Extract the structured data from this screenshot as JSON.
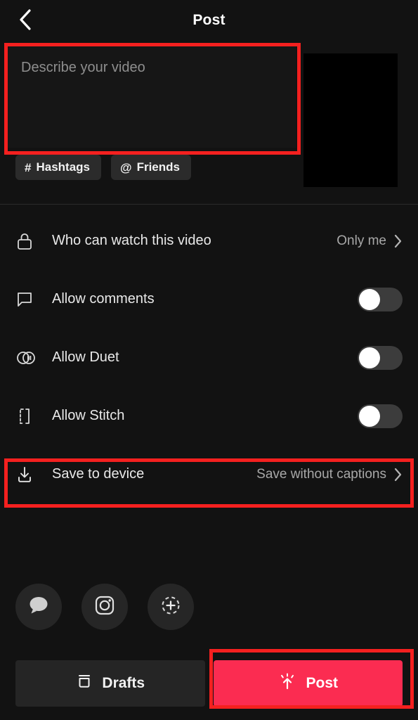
{
  "header": {
    "title": "Post",
    "back_icon": "chevron-left-icon"
  },
  "description": {
    "placeholder": "Describe your video",
    "value": "",
    "chips": [
      {
        "glyph": "#",
        "label": "Hashtags",
        "icon": "hashtag-icon"
      },
      {
        "glyph": "@",
        "label": "Friends",
        "icon": "at-mention-icon"
      }
    ],
    "thumbnail_alt": "video-thumbnail"
  },
  "settings": [
    {
      "icon": "lock-icon",
      "label": "Who can watch this video",
      "type": "value",
      "value": "Only me",
      "chevron": "chevron-right-icon"
    },
    {
      "icon": "comment-bubble-icon",
      "label": "Allow comments",
      "type": "toggle",
      "enabled": false
    },
    {
      "icon": "duet-icon",
      "label": "Allow Duet",
      "type": "toggle",
      "enabled": false
    },
    {
      "icon": "stitch-icon",
      "label": "Allow Stitch",
      "type": "toggle",
      "enabled": false
    },
    {
      "icon": "download-icon",
      "label": "Save to device",
      "type": "value",
      "value": "Save without captions",
      "chevron": "chevron-right-icon"
    }
  ],
  "share": [
    {
      "icon": "message-bubble-icon",
      "name": "messages"
    },
    {
      "icon": "instagram-icon",
      "name": "instagram"
    },
    {
      "icon": "add-more-icon",
      "name": "more"
    }
  ],
  "bottom": {
    "drafts_label": "Drafts",
    "drafts_icon": "archive-box-icon",
    "post_label": "Post",
    "post_icon": "upload-burst-icon"
  },
  "colors": {
    "accent": "#FB2C51",
    "background": "#121212",
    "annotation": "#F4201F",
    "toggle_track": "#3C3C3C",
    "chip_bg": "#2B2B2B"
  },
  "annotations": [
    {
      "name": "description-box-highlight"
    },
    {
      "name": "save-to-device-highlight"
    },
    {
      "name": "post-button-highlight"
    }
  ]
}
